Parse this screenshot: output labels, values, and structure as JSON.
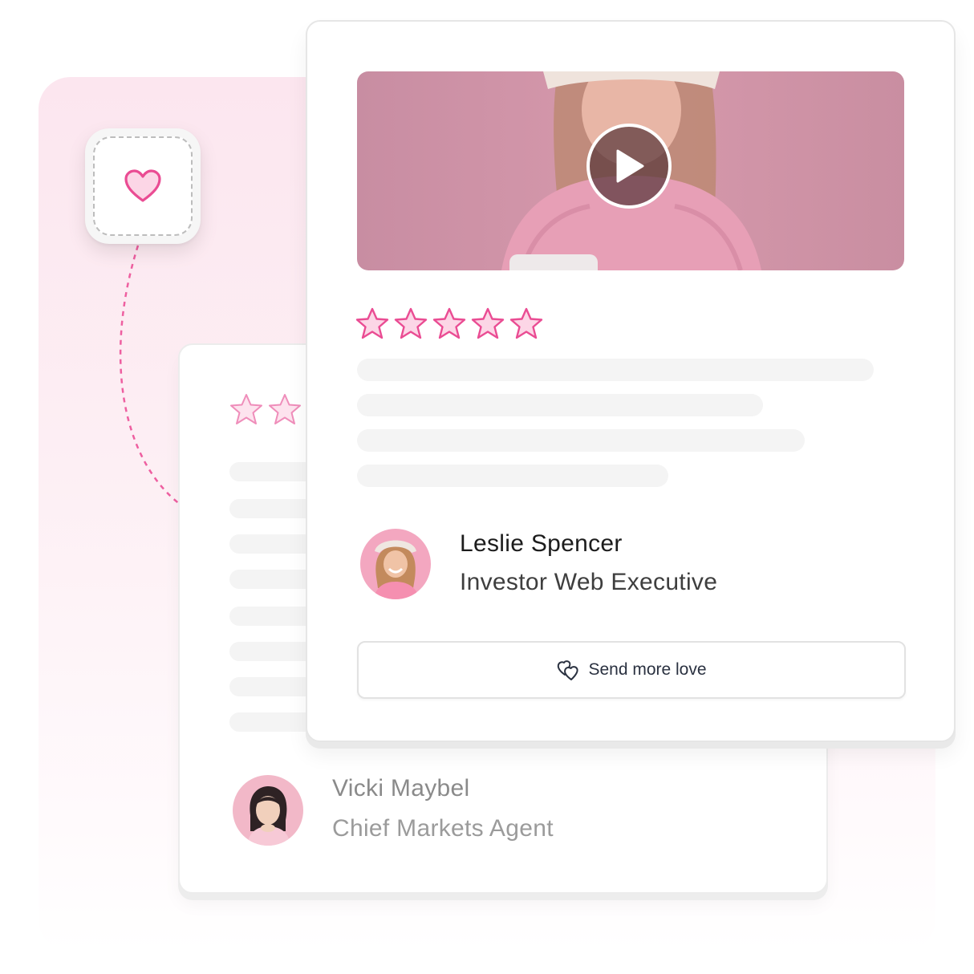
{
  "colors": {
    "accent_pink": "#ea4c93",
    "star_fill": "#fcd6e6",
    "text_dark": "#1c1c1c",
    "text_muted": "#8a8a8a"
  },
  "heart_tile": {
    "icon": "heart-icon"
  },
  "featured_testimonial": {
    "media": {
      "type": "video",
      "play_icon": "play-icon"
    },
    "rating": 5,
    "name": "Leslie Spencer",
    "role": "Investor Web Executive",
    "cta_label": "Send more love",
    "cta_icon": "hearts-icon"
  },
  "background_testimonial": {
    "visible_rating_stars": 2,
    "name": "Vicki Maybel",
    "role": "Chief Markets Agent"
  }
}
